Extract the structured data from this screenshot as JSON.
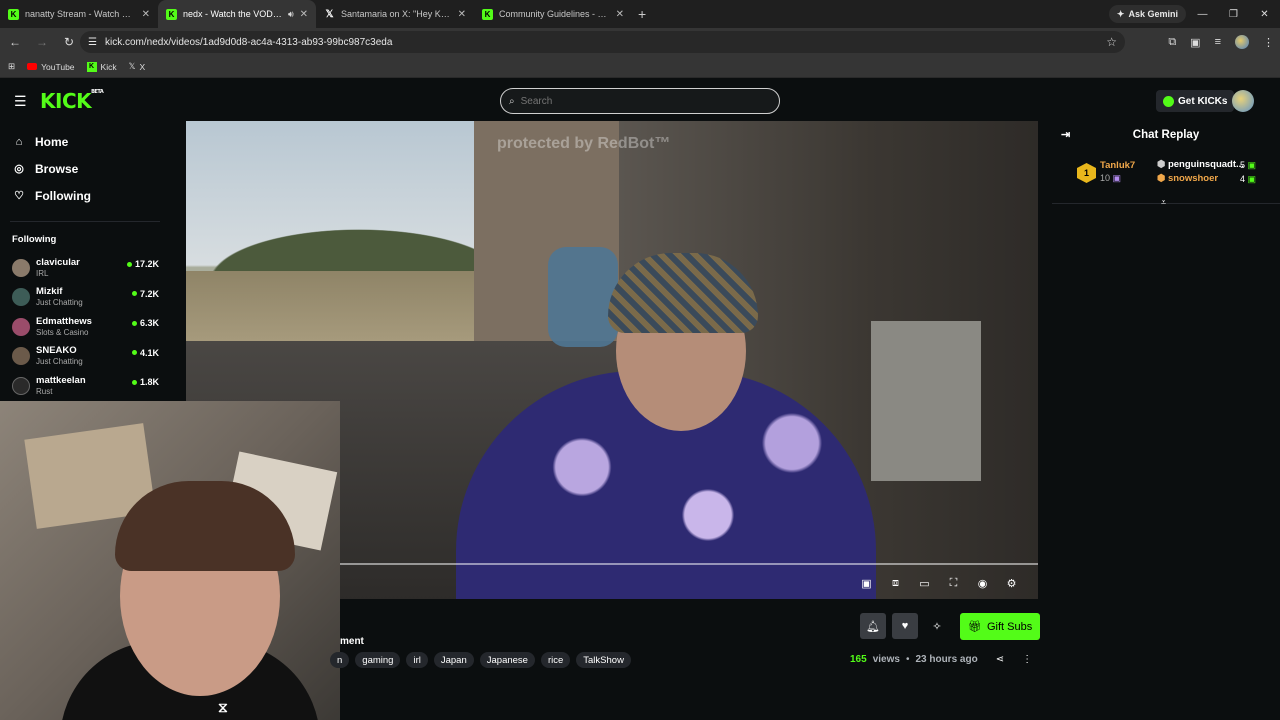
{
  "browser": {
    "tabs": [
      {
        "title": "nanatty Stream - Watch Live on",
        "favicon": "kick",
        "active": false
      },
      {
        "title": "nedx - Watch the VOD on K",
        "favicon": "kick",
        "active": true
      },
      {
        "title": "Santamaria on X: \"Hey KICK Co",
        "favicon": "x",
        "active": false
      },
      {
        "title": "Community Guidelines - Kick St",
        "favicon": "kick",
        "active": false
      }
    ],
    "ask_gemini": "Ask Gemini",
    "url": "kick.com/nedx/videos/1ad9d0d8-ac4a-4313-ab93-99bc987c3eda",
    "bookmarks": [
      "YouTube",
      "Kick",
      "X"
    ]
  },
  "kick": {
    "search_placeholder": "Search",
    "get_kicks": "Get KICKs",
    "nav": [
      {
        "label": "Home",
        "icon": "home-icon"
      },
      {
        "label": "Browse",
        "icon": "compass-icon"
      },
      {
        "label": "Following",
        "icon": "heart-icon"
      }
    ],
    "following_heading": "Following",
    "following": [
      {
        "name": "clavicular",
        "category": "IRL",
        "viewers": "17.2K"
      },
      {
        "name": "Mizkif",
        "category": "Just Chatting",
        "viewers": "7.2K"
      },
      {
        "name": "Edmatthews",
        "category": "Slots & Casino",
        "viewers": "6.3K"
      },
      {
        "name": "SNEAKO",
        "category": "Just Chatting",
        "viewers": "4.1K"
      },
      {
        "name": "mattkeelan",
        "category": "Rust",
        "viewers": "1.8K"
      }
    ],
    "video": {
      "watermark": "protected by RedBot™",
      "stream_title_fragment": "ment",
      "tags": [
        "n",
        "gaming",
        "irl",
        "Japan",
        "Japanese",
        "rice",
        "TalkShow"
      ],
      "views": "165",
      "views_label": "views",
      "age": "23 hours ago",
      "gift_subs": "Gift Subs"
    },
    "chat": {
      "title": "Chat Replay",
      "gifters": {
        "rank": "1",
        "top": {
          "name": "Tanluk7",
          "count": "10"
        },
        "second": {
          "name": "penguinsquadt...",
          "count": "5"
        },
        "third": {
          "name": "snowshoer",
          "count": "4"
        }
      }
    }
  }
}
